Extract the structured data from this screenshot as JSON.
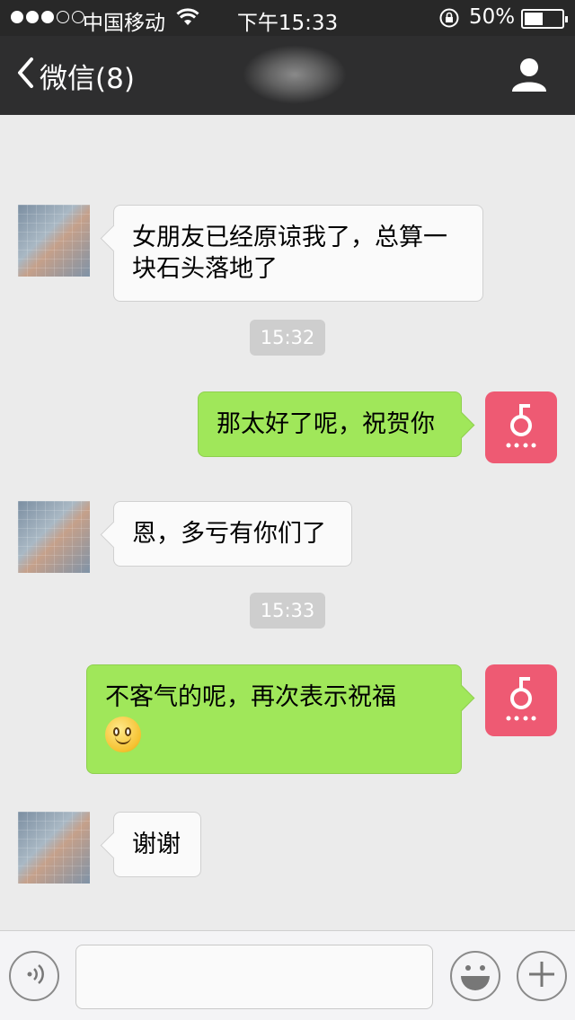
{
  "status_bar": {
    "carrier": "中国移动",
    "time": "下午15:33",
    "battery_percent": "50%",
    "battery_level": 0.5,
    "signal_bars_filled": 3,
    "signal_bars_total": 5,
    "icons": [
      "wifi-icon",
      "rotation-lock-icon",
      "battery-icon"
    ]
  },
  "nav": {
    "back_label": "微信(8)",
    "back_icon": "chevron-left-icon",
    "profile_icon": "person-icon"
  },
  "messages": [
    {
      "from": "friend",
      "text": "女朋友已经原谅我了，总算一块石头落地了"
    },
    {
      "type": "timestamp",
      "text": "15:32"
    },
    {
      "from": "me",
      "text": "那太好了呢，祝贺你"
    },
    {
      "from": "friend",
      "text": "恩，多亏有你们了"
    },
    {
      "type": "timestamp",
      "text": "15:33"
    },
    {
      "from": "me",
      "text": "不客气的呢，再次表示祝福",
      "emoji": "smiley-emoji"
    },
    {
      "from": "friend",
      "text": "谢谢"
    }
  ],
  "input_bar": {
    "value": "",
    "icons": [
      "voice-icon",
      "emoji-face-icon",
      "plus-icon"
    ]
  },
  "colors": {
    "outgoing_bubble": "#a0e75a",
    "incoming_bubble": "#fafafa",
    "nav_background": "#2e2e2f",
    "my_avatar": "#ee5a73"
  }
}
